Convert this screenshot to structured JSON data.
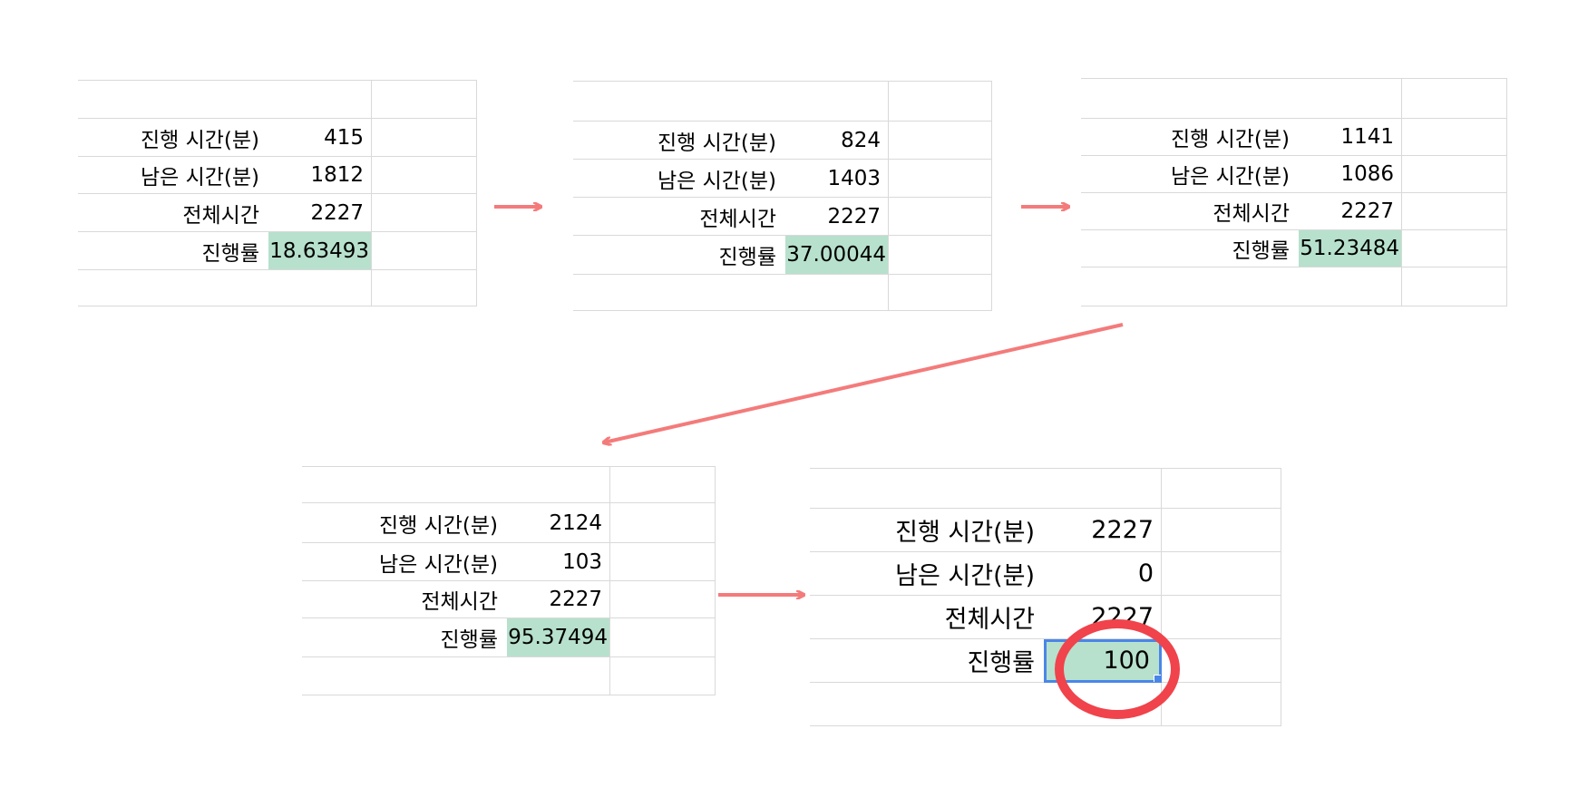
{
  "labels": {
    "elapsed": "진행 시간(분)",
    "remaining": "남은 시간(분)",
    "total": "전체시간",
    "progress": "진행률"
  },
  "steps": [
    {
      "elapsed": "415",
      "remaining": "1812",
      "total": "2227",
      "progress": "18.63493"
    },
    {
      "elapsed": "824",
      "remaining": "1403",
      "total": "2227",
      "progress": "37.00044"
    },
    {
      "elapsed": "1141",
      "remaining": "1086",
      "total": "2227",
      "progress": "51.23484"
    },
    {
      "elapsed": "2124",
      "remaining": "103",
      "total": "2227",
      "progress": "95.37494"
    },
    {
      "elapsed": "2227",
      "remaining": "0",
      "total": "2227",
      "progress": "100"
    }
  ],
  "colors": {
    "progress_fill": "#b7e1cd",
    "arrow": "#f47b7b",
    "circle": "#f0434b",
    "selection": "#4a86e8",
    "gridline": "#d9d9d9"
  },
  "icons": {
    "arrow": "right-arrow-icon",
    "highlight": "circle-annotation"
  }
}
